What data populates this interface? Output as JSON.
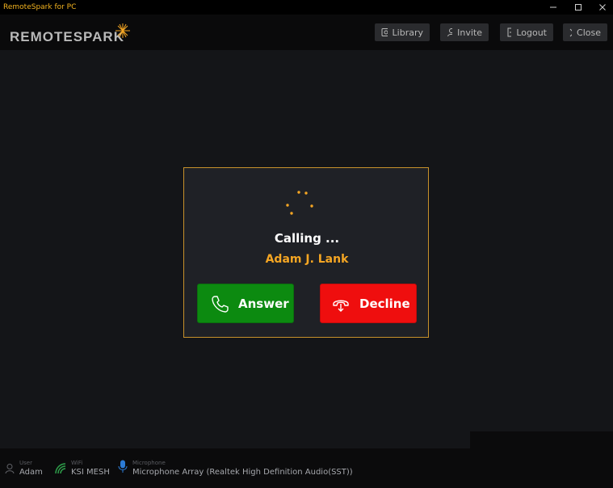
{
  "window": {
    "title": "RemoteSpark for PC"
  },
  "header": {
    "logo_text": "REMOTESPARK",
    "buttons": [
      {
        "label": "Library",
        "icon": "library-icon"
      },
      {
        "label": "Invite",
        "icon": "invite-icon"
      },
      {
        "label": "Logout",
        "icon": "logout-icon"
      },
      {
        "label": "Close",
        "icon": "close-icon"
      }
    ]
  },
  "call": {
    "status": "Calling ...",
    "caller": "Adam J. Lank",
    "answer_label": "Answer",
    "decline_label": "Decline"
  },
  "statusbar": {
    "user": {
      "caption": "User",
      "value": "Adam"
    },
    "wifi": {
      "caption": "WiFi",
      "value": "KSI MESH"
    },
    "microphone": {
      "caption": "Microphone",
      "value": "Microphone Array (Realtek High Definition Audio(SST))"
    }
  },
  "colors": {
    "accent": "#f5a623",
    "answer": "#0c8a10",
    "decline": "#ef0e0e",
    "dialog_border": "#c7912b"
  }
}
